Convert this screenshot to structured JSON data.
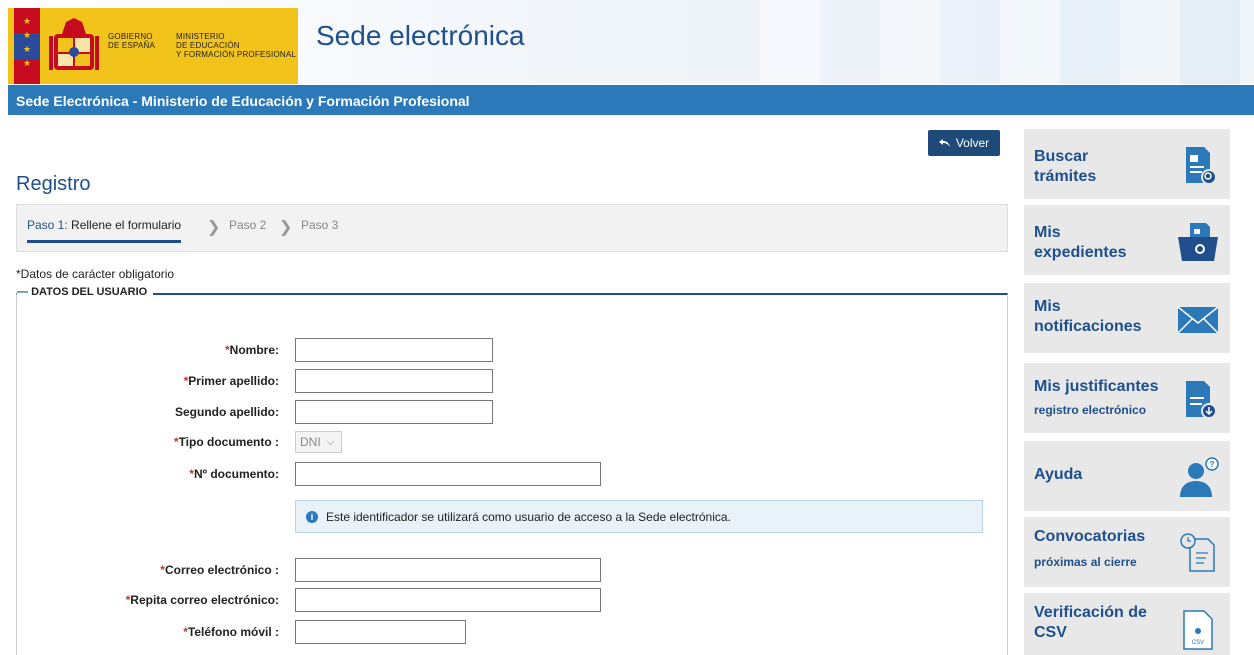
{
  "header": {
    "gov_line1": "GOBIERNO",
    "gov_line2": "DE ESPAÑA",
    "min_line1": "MINISTERIO",
    "min_line2": "DE EDUCACIÓN",
    "min_line3": "Y FORMACIÓN PROFESIONAL",
    "site_title": "Sede electrónica",
    "flag_colors": [
      "#c60b1e",
      "#2a4b9b",
      "#f2c31a"
    ]
  },
  "bluebar": {
    "title": "Sede Electrónica - Ministerio de Educación y Formación Profesional",
    "color": "#2b79b8"
  },
  "main": {
    "volver_label": "Volver",
    "page_title": "Registro",
    "steps": {
      "step1_prefix": "Paso 1:",
      "step1_label": "Rellene el formulario",
      "step2": "Paso 2",
      "step3": "Paso 3"
    },
    "required_note": "*Datos de carácter obligatorio",
    "section_title": "DATOS DEL USUARIO",
    "fields": {
      "nombre": {
        "label": "Nombre:",
        "value": ""
      },
      "primer_apellido": {
        "label": "Primer apellido:",
        "value": ""
      },
      "segundo_apellido": {
        "label": "Segundo apellido:",
        "value": ""
      },
      "tipo_documento": {
        "label": "Tipo documento :",
        "value": "DNI"
      },
      "num_documento": {
        "label": "Nº documento:",
        "value": ""
      },
      "correo": {
        "label": "Correo electrónico :",
        "value": ""
      },
      "repita_correo": {
        "label": "Repita correo electrónico:",
        "value": ""
      },
      "telefono": {
        "label": "Teléfono móvil :",
        "value": ""
      }
    },
    "info_text": "Este identificador se utilizará como usuario de acceso a la Sede electrónica."
  },
  "sidebar": {
    "items": [
      {
        "title1": "Buscar",
        "title2": "trámites",
        "icon": "search-document-icon"
      },
      {
        "title1": "Mis",
        "title2": "expedientes",
        "icon": "folder-search-icon"
      },
      {
        "title1": "Mis",
        "title2": "notificaciones",
        "icon": "envelope-icon"
      },
      {
        "title1": "Mis justificantes",
        "sub": "registro electrónico",
        "icon": "download-document-icon"
      },
      {
        "title1": "Ayuda",
        "icon": "user-help-icon"
      },
      {
        "title1": "Convocatorias",
        "sub": "próximas al cierre",
        "icon": "clock-document-icon"
      },
      {
        "title1": "Verificación de",
        "title2": "CSV",
        "icon": "csv-document-icon",
        "icon_text": "CSV"
      }
    ],
    "accent": "#1f4f8c"
  }
}
